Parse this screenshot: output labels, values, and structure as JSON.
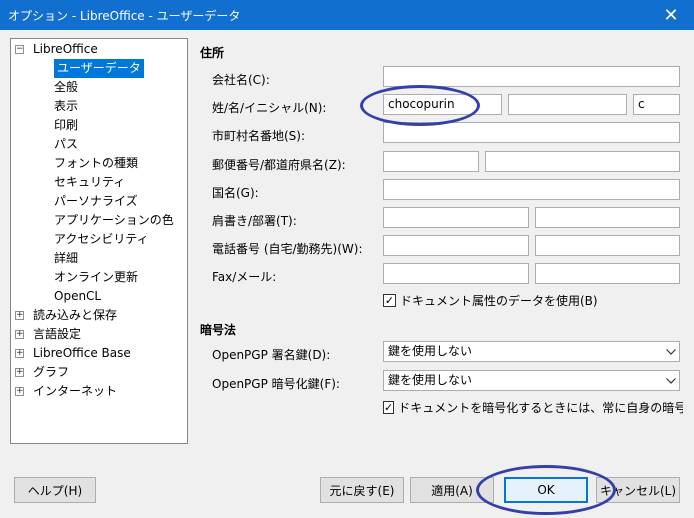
{
  "window": {
    "title": "オプション - LibreOffice - ユーザーデータ",
    "close_glyph": "✕"
  },
  "tree": {
    "items": [
      {
        "label": "LibreOffice",
        "expander": "−"
      },
      {
        "label": "ユーザーデータ"
      },
      {
        "label": "全般"
      },
      {
        "label": "表示"
      },
      {
        "label": "印刷"
      },
      {
        "label": "パス"
      },
      {
        "label": "フォントの種類"
      },
      {
        "label": "セキュリティ"
      },
      {
        "label": "パーソナライズ"
      },
      {
        "label": "アプリケーションの色"
      },
      {
        "label": "アクセシビリティ"
      },
      {
        "label": "詳細"
      },
      {
        "label": "オンライン更新"
      },
      {
        "label": "OpenCL"
      },
      {
        "label": "読み込みと保存",
        "expander": "+"
      },
      {
        "label": "言語設定",
        "expander": "+"
      },
      {
        "label": "LibreOffice Base",
        "expander": "+"
      },
      {
        "label": "グラフ",
        "expander": "+"
      },
      {
        "label": "インターネット",
        "expander": "+"
      }
    ],
    "selected": "ユーザーデータ"
  },
  "address": {
    "section_title": "住所",
    "company_label": "会社名(C):",
    "name_label": "姓/名/イニシャル(N):",
    "name_first": "chocopurin",
    "name_last": "",
    "initials": "c",
    "street_label": "市町村名番地(S):",
    "zip_label": "郵便番号/都道府県名(Z):",
    "country_label": "国名(G):",
    "title_label": "肩書き/部署(T):",
    "phone_label": "電話番号 (自宅/勤務先)(W):",
    "fax_label": "Fax/メール:",
    "use_doc_props_label": "ドキュメント属性のデータを使用(B)",
    "use_doc_props_checked": "✓"
  },
  "crypto": {
    "section_title": "暗号法",
    "sign_key_label": "OpenPGP 署名鍵(D):",
    "sign_key_value": "鍵を使用しない",
    "enc_key_label": "OpenPGP 暗号化鍵(F):",
    "enc_key_value": "鍵を使用しない",
    "always_encrypt_label": "ドキュメントを暗号化するときには、常に自身の暗号化鍵でも",
    "always_encrypt_checked": "✓"
  },
  "buttons": {
    "help": "ヘルプ(H)",
    "reset": "元に戻す(E)",
    "apply": "適用(A)",
    "ok": "OK",
    "cancel": "キャンセル(L)"
  },
  "annotation_color": "#3340a8"
}
